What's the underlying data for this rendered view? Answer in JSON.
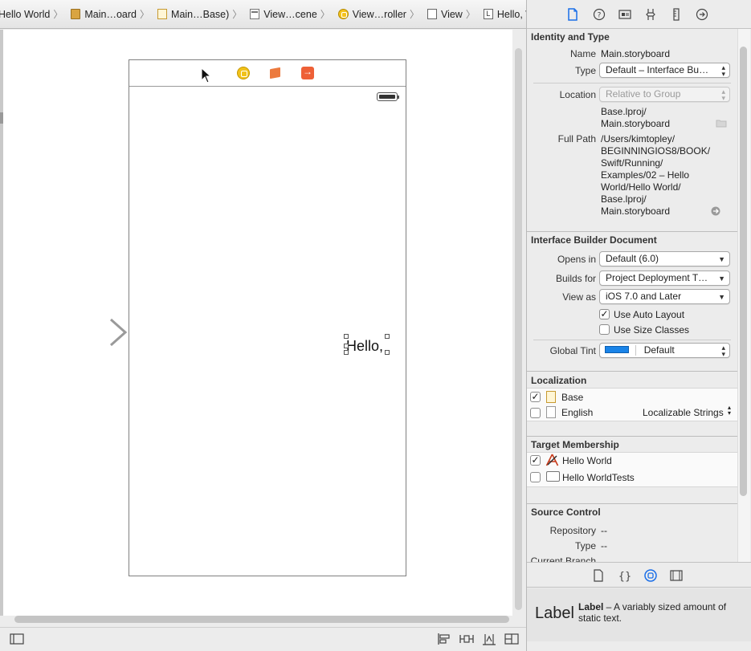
{
  "jumpbar": {
    "crumbs": [
      {
        "label": "Hello World",
        "icon": "project-icon"
      },
      {
        "label": "Main…oard",
        "icon": "storyboard-icon"
      },
      {
        "label": "Main…Base)",
        "icon": "file-icon"
      },
      {
        "label": "View…cene",
        "icon": "scene-icon"
      },
      {
        "label": "View…roller",
        "icon": "view-controller-icon"
      },
      {
        "label": "View",
        "icon": "view-icon"
      },
      {
        "label": "Hello, World!",
        "icon": "label-icon"
      }
    ],
    "label_icon_glyph": "L"
  },
  "canvas": {
    "label_text": "Hello, World!"
  },
  "inspector": {
    "identity": {
      "title": "Identity and Type",
      "name_label": "Name",
      "name_value": "Main.storyboard",
      "type_label": "Type",
      "type_value": "Default – Interface Bu…",
      "location_label": "Location",
      "location_value": "Relative to Group",
      "relative_path_1": "Base.lproj/",
      "relative_path_2": "Main.storyboard",
      "full_path_label": "Full Path",
      "full_path_lines": [
        "/Users/kimtopley/",
        "BEGINNINGIOS8/BOOK/",
        "Swift/Running/",
        "Examples/02 – Hello",
        "World/Hello World/",
        "Base.lproj/",
        "Main.storyboard"
      ]
    },
    "ib_document": {
      "title": "Interface Builder Document",
      "opens_in_label": "Opens in",
      "opens_in_value": "Default (6.0)",
      "builds_for_label": "Builds for",
      "builds_for_value": "Project Deployment T…",
      "view_as_label": "View as",
      "view_as_value": "iOS 7.0 and Later",
      "auto_layout_label": "Use Auto Layout",
      "auto_layout_checked": true,
      "size_classes_label": "Use Size Classes",
      "size_classes_checked": false,
      "global_tint_label": "Global Tint",
      "global_tint_value": "Default",
      "global_tint_color": "#1a84e8"
    },
    "localization": {
      "title": "Localization",
      "items": [
        {
          "label": "Base",
          "checked": true
        },
        {
          "label": "English",
          "checked": false,
          "mode": "Localizable Strings"
        }
      ]
    },
    "target_membership": {
      "title": "Target Membership",
      "items": [
        {
          "label": "Hello World",
          "checked": true
        },
        {
          "label": "Hello WorldTests",
          "checked": false
        }
      ]
    },
    "source_control": {
      "title": "Source Control",
      "repository_label": "Repository",
      "repository_value": "--",
      "type_label": "Type",
      "type_value": "--",
      "current_branch_label": "Current Branch"
    }
  },
  "library": {
    "item_title": "Label",
    "item_desc_bold": "Label",
    "item_desc_rest": " – A variably sized amount of static text."
  }
}
